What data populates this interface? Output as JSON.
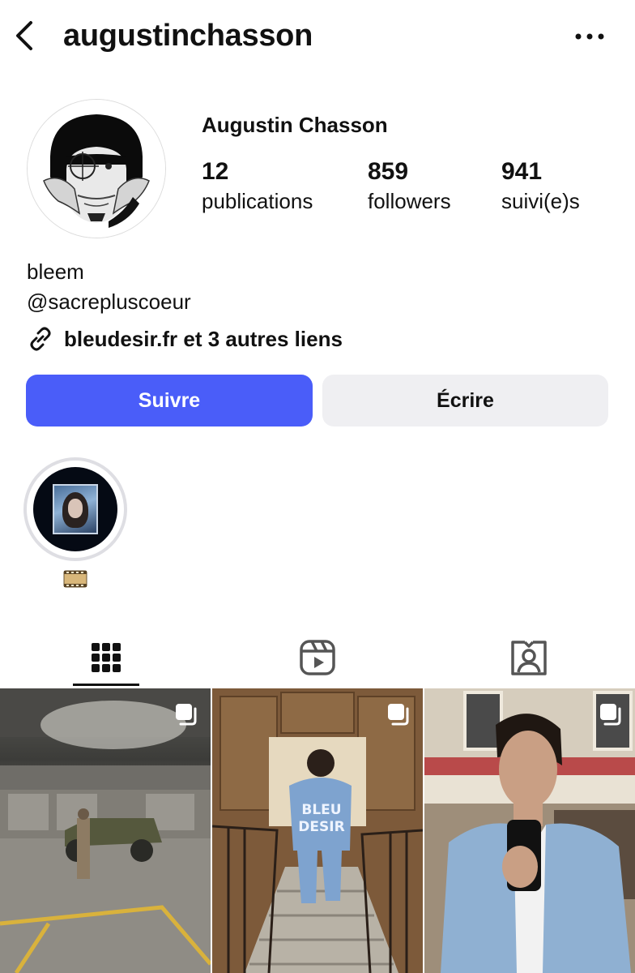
{
  "header": {
    "username": "augustinchasson",
    "back_icon": "chevron-left-icon",
    "more_icon": "more-horizontal-icon"
  },
  "profile": {
    "full_name": "Augustin Chasson",
    "stats": [
      {
        "value": "12",
        "label": "publications"
      },
      {
        "value": "859",
        "label": "followers"
      },
      {
        "value": "941",
        "label": "suivi(e)s"
      }
    ],
    "bio_lines": [
      "bleem",
      "@sacrepluscoeur"
    ],
    "link_text": "bleudesir.fr et 3 autres liens"
  },
  "actions": {
    "follow_label": "Suivre",
    "message_label": "Écrire",
    "follow_color": "#4a5df9",
    "message_color": "#efeff2"
  },
  "highlights": [
    {
      "label_icon": "film-reel-emoji"
    }
  ],
  "tabs": [
    {
      "icon": "grid-icon",
      "active": true
    },
    {
      "icon": "reels-icon",
      "active": false
    },
    {
      "icon": "tagged-icon",
      "active": false
    }
  ],
  "posts": [
    {
      "icon": "multiple-photos-icon"
    },
    {
      "icon": "multiple-photos-icon"
    },
    {
      "icon": "multiple-photos-icon"
    }
  ]
}
